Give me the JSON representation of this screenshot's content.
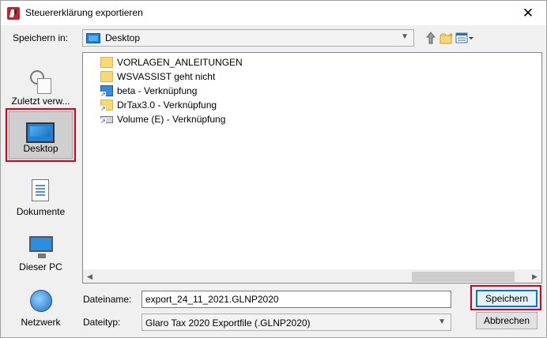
{
  "window": {
    "title": "Steuererklärung exportieren"
  },
  "savein": {
    "label": "Speichern in:",
    "value": "Desktop"
  },
  "toolbar": {
    "up_icon": "up-folder-icon",
    "new_folder_icon": "new-folder-icon",
    "view_menu_icon": "view-menu-icon"
  },
  "places": [
    {
      "label": "Zuletzt verw...",
      "icon": "recent-places-icon"
    },
    {
      "label": "Desktop",
      "icon": "desktop-icon",
      "selected": true
    },
    {
      "label": "Dokumente",
      "icon": "documents-icon"
    },
    {
      "label": "Dieser PC",
      "icon": "this-pc-icon"
    },
    {
      "label": "Netzwerk",
      "icon": "network-icon"
    }
  ],
  "files": [
    {
      "name": "VORLAGEN_ANLEITUNGEN",
      "type": "folder"
    },
    {
      "name": "WSVASSIST geht nicht",
      "type": "folder"
    },
    {
      "name": "beta - Verknüpfung",
      "type": "shortcut"
    },
    {
      "name": "DrTax3.0 - Verknüpfung",
      "type": "shortcut"
    },
    {
      "name": "Volume (E) - Verknüpfung",
      "type": "shortcut"
    }
  ],
  "filename": {
    "label": "Dateiname:",
    "value": "export_24_11_2021.GLNP2020"
  },
  "filetype": {
    "label": "Dateityp:",
    "value": "Glaro Tax 2020 Exportfile (.GLNP2020)"
  },
  "buttons": {
    "save": "Speichern",
    "cancel": "Abbrechen"
  },
  "colors": {
    "highlight_red": "#d9001e",
    "accent_blue": "#0078d7"
  }
}
